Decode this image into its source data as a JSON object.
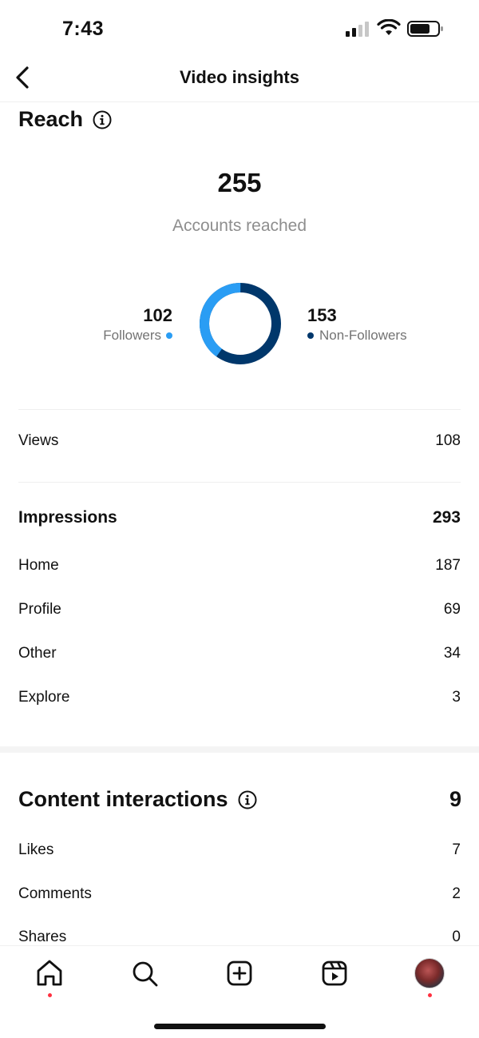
{
  "status_bar": {
    "time": "7:43"
  },
  "nav": {
    "title": "Video insights"
  },
  "reach": {
    "title": "Reach",
    "accounts_reached": "255",
    "accounts_reached_label": "Accounts reached",
    "followers": {
      "value": "102",
      "label": "Followers",
      "color": "#2a9df4"
    },
    "non_followers": {
      "value": "153",
      "label": "Non-Followers",
      "color": "#00376b"
    }
  },
  "views": {
    "label": "Views",
    "value": "108"
  },
  "impressions": {
    "label": "Impressions",
    "total": "293",
    "rows": [
      {
        "label": "Home",
        "value": "187"
      },
      {
        "label": "Profile",
        "value": "69"
      },
      {
        "label": "Other",
        "value": "34"
      },
      {
        "label": "Explore",
        "value": "3"
      }
    ]
  },
  "content_interactions": {
    "title": "Content interactions",
    "total": "9",
    "rows": [
      {
        "label": "Likes",
        "value": "7"
      },
      {
        "label": "Comments",
        "value": "2"
      },
      {
        "label": "Shares",
        "value": "0"
      }
    ]
  },
  "tab_bar": {
    "items": [
      "home-icon",
      "search-icon",
      "create-icon",
      "reels-icon",
      "profile-avatar"
    ],
    "notification_dot_color": "#ff3040"
  }
}
